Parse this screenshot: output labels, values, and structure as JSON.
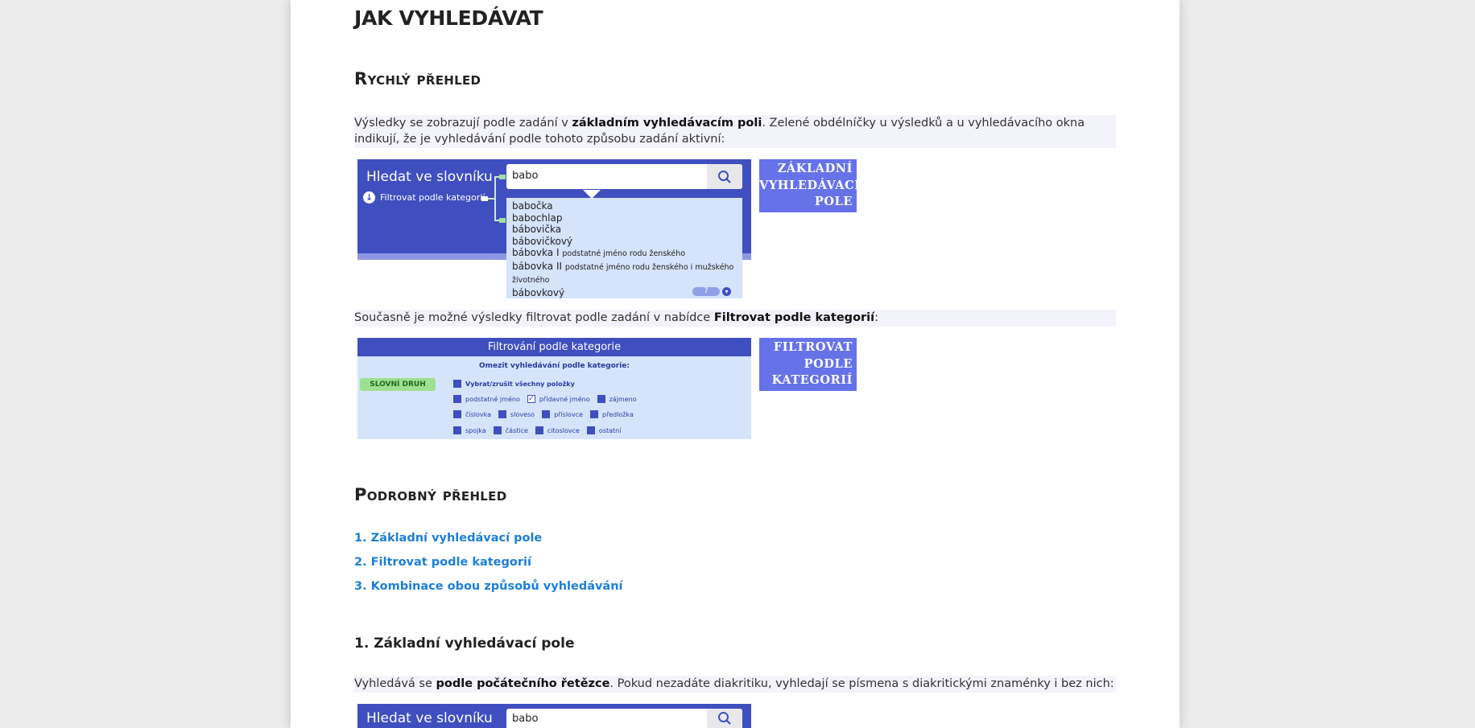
{
  "page_title": "JAK VYHLEDÁVAT",
  "sections": {
    "rychly": {
      "heading": "Rychlý přehled"
    },
    "podrobny": {
      "heading": "Podrobný přehled"
    },
    "zakladni": {
      "heading": "1. Základní vyhledávací pole"
    }
  },
  "para1": {
    "text_before": "Výsledky se zobrazují podle zadání v ",
    "bold": "základním vyhledávacím poli",
    "text_after": ". Zelené obdélníčky u výsledků a u vyhledávacího okna indikují, že je vyhledávání podle tohoto způsobu zadání aktivní:"
  },
  "para2": {
    "text_before": "Současně je možné výsledky filtrovat podle zadání v nabídce ",
    "bold": "Filtrovat podle kategorií",
    "text_after": ":"
  },
  "para3": {
    "text_before": "Vyhledává se ",
    "bold": "podle počátečního řetězce",
    "text_after": ". Pokud nezadáte diakritiku, vyhledají se písmena s diakritickými znaménky i bez nich:"
  },
  "search_demo": {
    "title": "Hledat ve slovníku",
    "filter_label": "Filtrovat podle kategorií",
    "query": "babo",
    "results": [
      {
        "word": "babočka",
        "note": ""
      },
      {
        "word": "babochlap",
        "note": ""
      },
      {
        "word": "bábovička",
        "note": ""
      },
      {
        "word": "bábovičkový",
        "note": ""
      },
      {
        "word": "bábovka I",
        "note": "podstatné jméno rodu ženského"
      },
      {
        "word": "bábovka II",
        "note": "podstatné jméno rodu ženského i mužského životného"
      },
      {
        "word": "bábovkový",
        "note": ""
      }
    ],
    "count": "7"
  },
  "search_demo2": {
    "title": "Hledat ve slovníku",
    "query": "babo"
  },
  "label_basic": [
    "ZÁKLADNÍ",
    "VYHLEDÁVACÍ",
    "POLE"
  ],
  "label_filter": [
    "FILTROVAT",
    "PODLE",
    "KATEGORIÍ"
  ],
  "filter_demo": {
    "header": "Filtrování podle kategorie",
    "subheader": "Omezit vyhledávání podle kategorie:",
    "category_button": "SLOVNÍ DRUH",
    "select_all": "Vybrat/zrušit všechny položky",
    "rows": [
      [
        "podstatné jméno",
        "přídavné jméno",
        "zájmeno"
      ],
      [
        "číslovka",
        "sloveso",
        "příslovce",
        "předložka"
      ],
      [
        "spojka",
        "částice",
        "citoslovce",
        "ostatní"
      ]
    ],
    "checked": "přídavné jméno"
  },
  "links": [
    "1. Základní vyhledávací pole",
    "2. Filtrovat podle kategorií",
    "3. Kombinace obou způsobů vyhledávání"
  ],
  "colors": {
    "accent_blue": "#3f4fbf",
    "label_purple": "#6672e8",
    "link_blue": "#1d7fd6",
    "para_bg": "#f3f3fb"
  }
}
